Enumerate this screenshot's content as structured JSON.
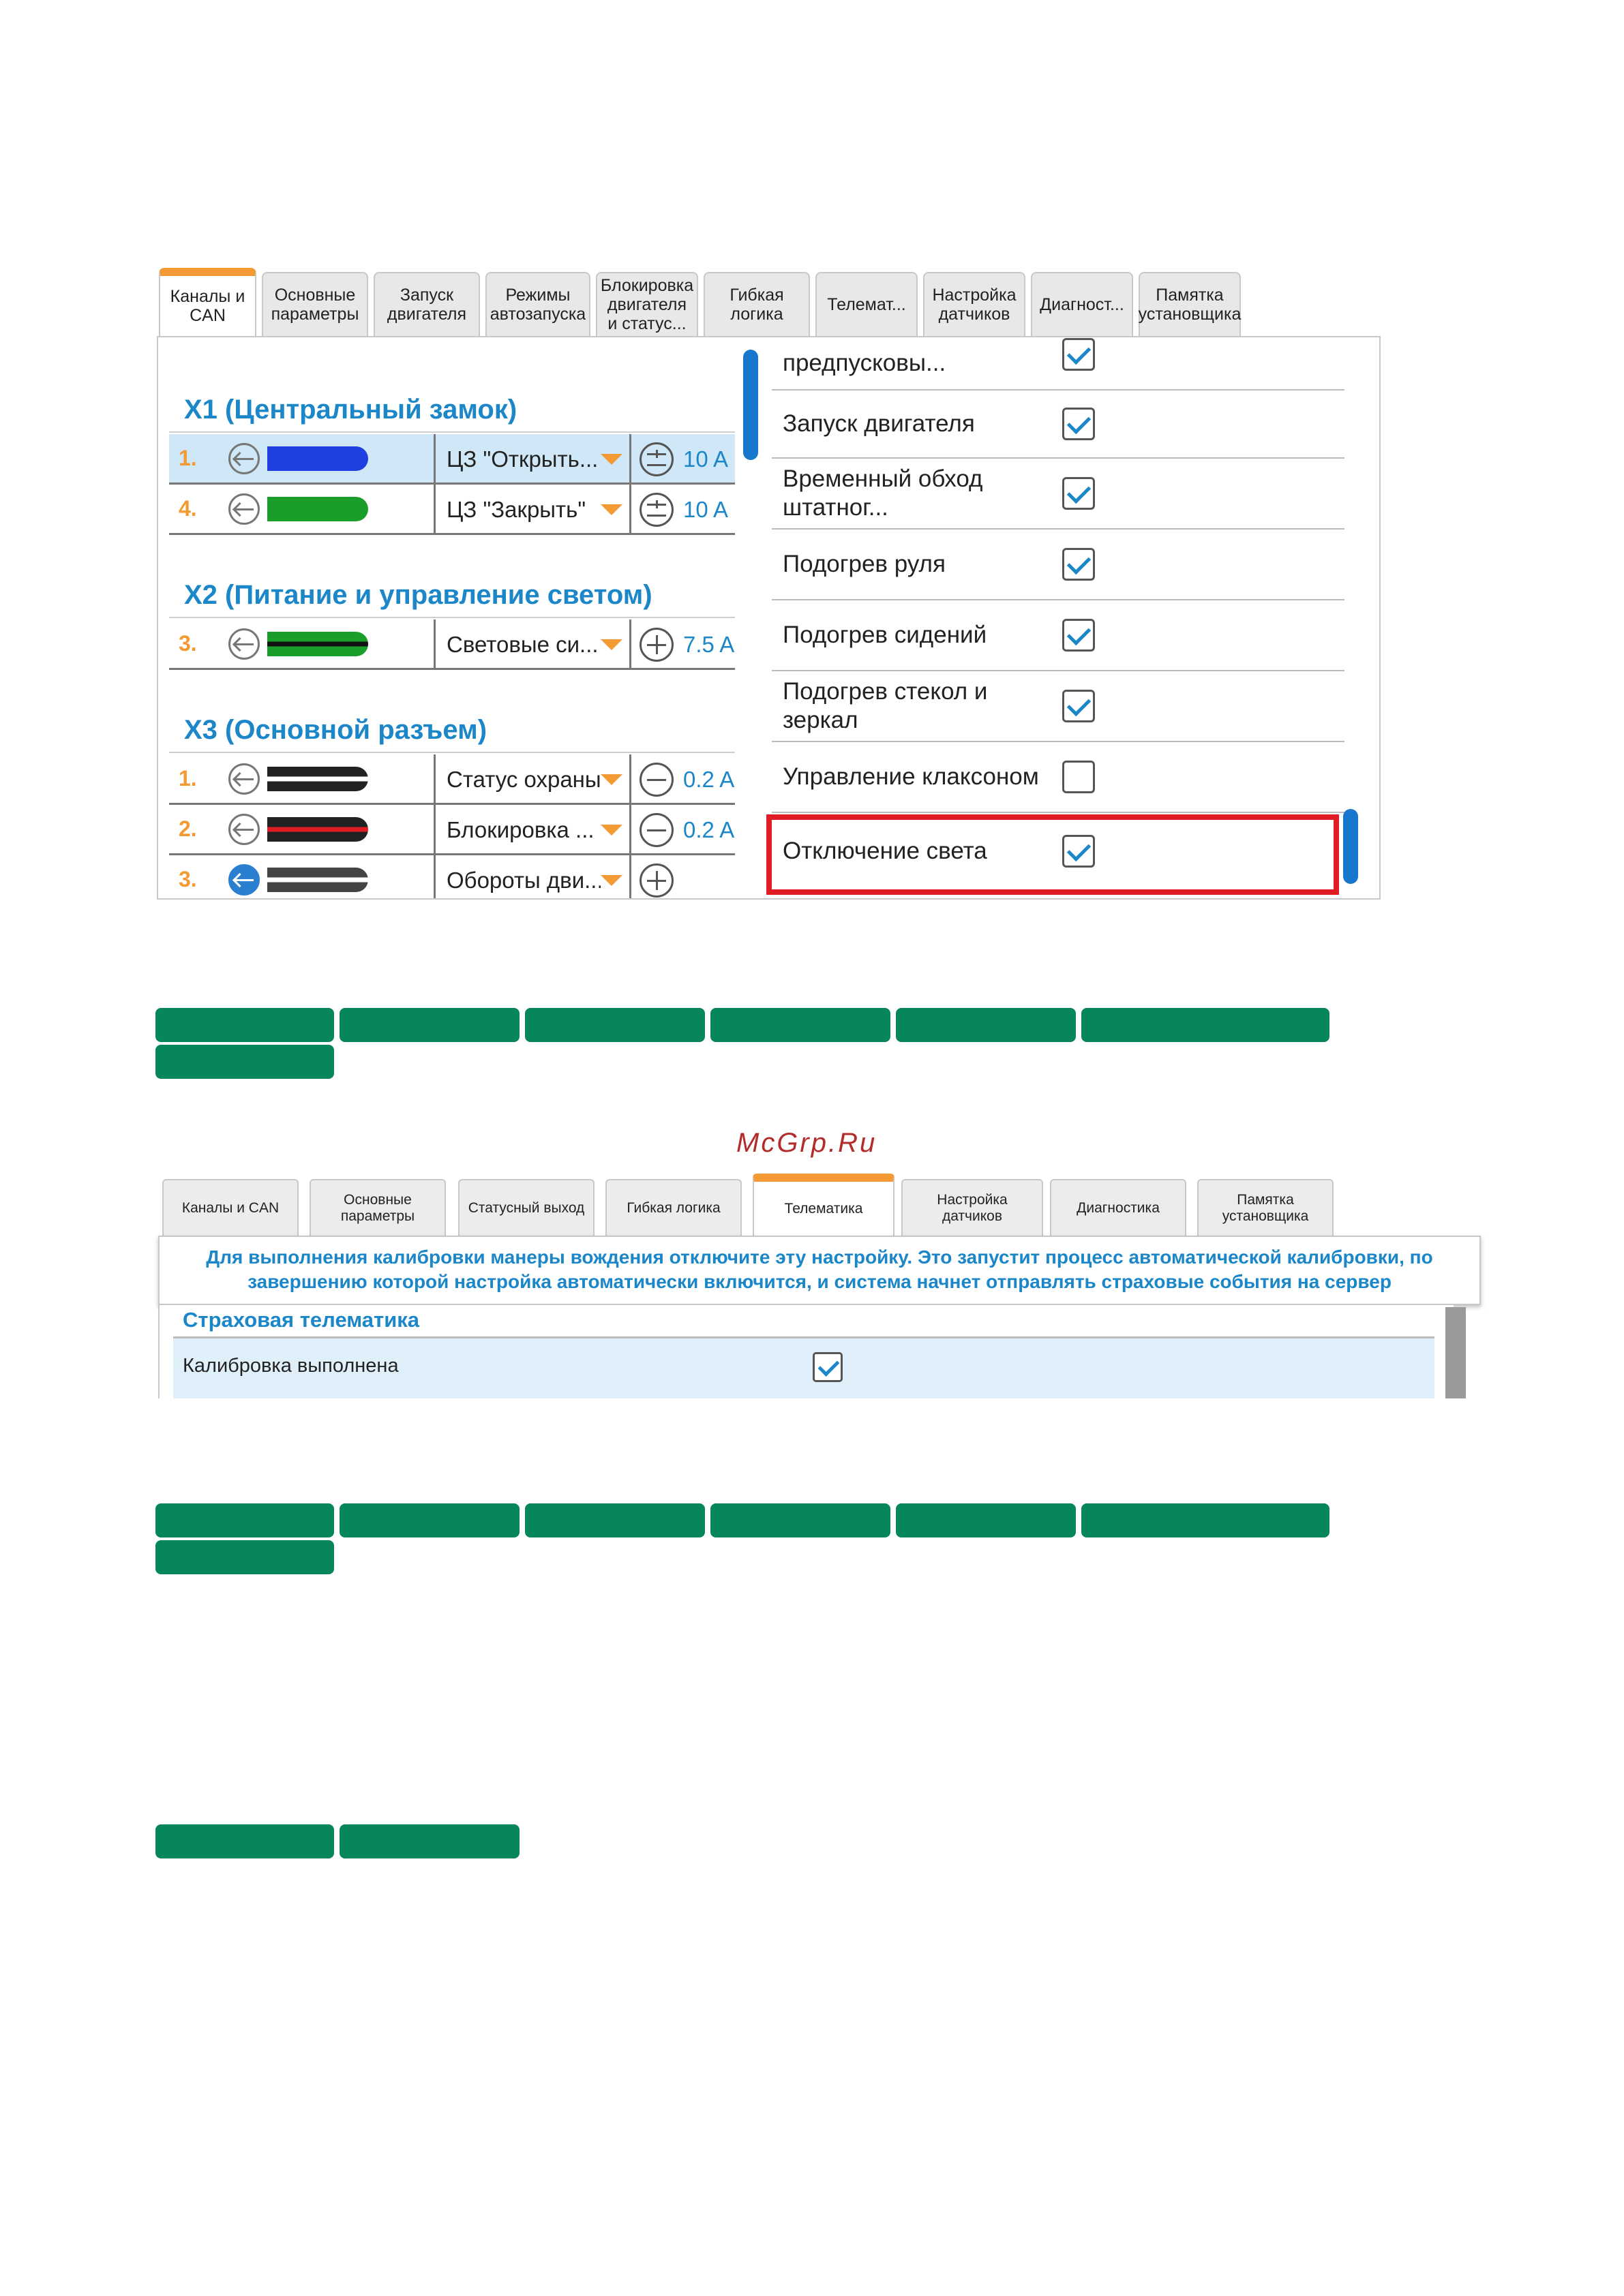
{
  "shot1": {
    "tabs": [
      {
        "label": "Каналы и\nCAN",
        "active": true
      },
      {
        "label": "Основные\nпараметры"
      },
      {
        "label": "Запуск\nдвигателя"
      },
      {
        "label": "Режимы\nавтозапуска"
      },
      {
        "label": "Блокировка\nдвигателя\nи статус..."
      },
      {
        "label": "Гибкая\nлогика"
      },
      {
        "label": "Телемат..."
      },
      {
        "label": "Настройка\nдатчиков"
      },
      {
        "label": "Диагност..."
      },
      {
        "label": "Памятка\nустановщика"
      }
    ],
    "groups": [
      {
        "title": "X1 (Центральный замок)",
        "rows": [
          {
            "num": "1.",
            "wire": "#1f3fe0",
            "select": "ЦЗ \"Открыть...",
            "current": "10 A",
            "sign": "plusminus",
            "selected": true
          },
          {
            "num": "4.",
            "wire": "#1a9e2a",
            "select": "ЦЗ \"Закрыть\"",
            "current": "10 A",
            "sign": "plusminus"
          }
        ]
      },
      {
        "title": "X2 (Питание и управление светом)",
        "rows": [
          {
            "num": "3.",
            "wire": "#1a9e2a",
            "stripe": "#111111",
            "select": "Световые си...",
            "current": "7.5 A",
            "sign": "plus"
          }
        ]
      },
      {
        "title": "X3 (Основной разъем)",
        "rows": [
          {
            "num": "1.",
            "wire": "#222222",
            "stripe": "#ffffff",
            "select": "Статус охраны",
            "current": "0.2 A",
            "sign": "minus"
          },
          {
            "num": "2.",
            "wire": "#222222",
            "stripe": "#e01d25",
            "select": "Блокировка ...",
            "current": "0.2 A",
            "sign": "minus"
          },
          {
            "num": "3.",
            "wire": "#444444",
            "stripe": "#ffffff",
            "select": "Обороты дви...",
            "current": "",
            "sign": "plus",
            "blueicon": true
          }
        ]
      }
    ],
    "options": [
      {
        "label": "предпусковы...",
        "checked": true
      },
      {
        "label": "Запуск двигателя",
        "checked": true
      },
      {
        "label": "Временный обход\nштатног...",
        "checked": true
      },
      {
        "label": "Подогрев руля",
        "checked": true
      },
      {
        "label": "Подогрев сидений",
        "checked": true
      },
      {
        "label": "Подогрев стекол и\nзеркал",
        "checked": true
      },
      {
        "label": "Управление клаксоном",
        "checked": false
      },
      {
        "label": "Отключение света",
        "checked": true
      }
    ]
  },
  "watermark": "McGrp.Ru",
  "shot2": {
    "tabs": [
      {
        "label": "Каналы и CAN"
      },
      {
        "label": "Основные\nпараметры"
      },
      {
        "label": "Статусный выход"
      },
      {
        "label": "Гибкая логика"
      },
      {
        "label": "Телематика",
        "active": true
      },
      {
        "label": "Настройка\nдатчиков"
      },
      {
        "label": "Диагностика"
      },
      {
        "label": "Памятка\nустановщика"
      }
    ],
    "banner_line1": "Для выполнения калибровки манеры вождения отключите эту настройку. Это запустит процесс автоматической калибровки, по",
    "banner_line2": "завершению которой настройка автоматически включится, и система начнет отправлять страховые события на сервер",
    "section_title": "Страховая телематика",
    "row_label": "Калибровка выполнена",
    "row_checked": true
  },
  "colors": {
    "accent_orange": "#f39a35",
    "text_blue": "#1b86c8",
    "scroll_blue": "#1777cc",
    "highlight_red": "#e01d25",
    "bar_green": "#07865a",
    "selected_row": "#cfe7f6"
  }
}
